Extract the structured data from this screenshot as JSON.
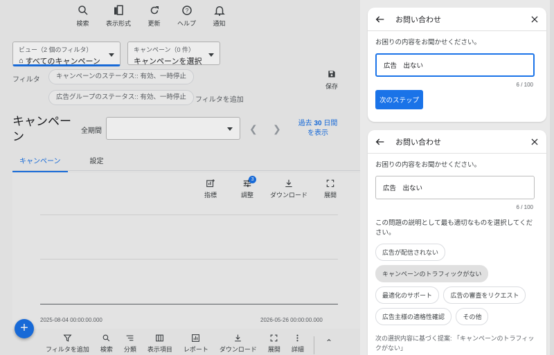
{
  "toolbar": {
    "items": [
      {
        "label": "検索",
        "icon": "search-icon"
      },
      {
        "label": "表示形式",
        "icon": "view-format-icon"
      },
      {
        "label": "更新",
        "icon": "refresh-icon"
      },
      {
        "label": "ヘルプ",
        "icon": "help-icon"
      },
      {
        "label": "通知",
        "icon": "bell-icon"
      }
    ]
  },
  "view": {
    "label": "ビュー（2 個のフィルタ）",
    "value": "すべてのキャンペーン"
  },
  "campaign_select": {
    "label": "キャンペーン（0 件）",
    "value": "キャンペーンを選択"
  },
  "filters": {
    "label": "フィルタ",
    "chips": [
      "キャンペーンのステータス:: 有効、一時停止",
      "広告グループのステータス:: 有効、一時停止"
    ],
    "add_filter": "フィルタを追加",
    "save": "保存"
  },
  "page": {
    "title": "キャンペーン",
    "period_label": "全期間",
    "range_link_prefix": "過去 ",
    "range_link_number": "30",
    "range_link_suffix": " 日間",
    "range_link_line2": "を表示"
  },
  "tabs": [
    "キャンペーン",
    "設定"
  ],
  "chart_tools": [
    {
      "label": "指標",
      "icon": "add-chart-icon"
    },
    {
      "label": "調整",
      "icon": "tune-icon",
      "badge": "3"
    },
    {
      "label": "ダウンロード",
      "icon": "download-icon"
    },
    {
      "label": "展開",
      "icon": "expand-icon"
    }
  ],
  "chart": {
    "start_date": "2025-08-04 00:00:00.000",
    "end_date": "2026-05-26 00:00:00.000"
  },
  "fab": "+",
  "bottombar": [
    {
      "label": "フィルタを追加",
      "icon": "filter-icon"
    },
    {
      "label": "検索",
      "icon": "search-icon"
    },
    {
      "label": "分類",
      "icon": "segment-icon"
    },
    {
      "label": "表示項目",
      "icon": "columns-icon"
    },
    {
      "label": "レポート",
      "icon": "report-icon"
    },
    {
      "label": "ダウンロード",
      "icon": "download-icon"
    },
    {
      "label": "展開",
      "icon": "expand-icon"
    },
    {
      "label": "詳細",
      "icon": "more-icon"
    }
  ],
  "contact1": {
    "title": "お問い合わせ",
    "question": "お困りの内容をお聞かせください。",
    "input_value": "広告　出ない",
    "count": "6 / 100",
    "next": "次のステップ"
  },
  "contact2": {
    "title": "お問い合わせ",
    "question": "お困りの内容をお聞かせください。",
    "input_value": "広告　出ない",
    "count": "6 / 100",
    "prompt": "この問題の説明として最も適切なものを選択してください。",
    "options": [
      "広告が配信されない",
      "キャンペーンのトラフィックがない",
      "最適化のサポート",
      "広告の審査をリクエスト",
      "広告主様の適格性確認",
      "その他"
    ],
    "selected_index": 1,
    "suggestion": "次の選択内容に基づく提案: 「キャンペーンのトラフィックがない」"
  }
}
